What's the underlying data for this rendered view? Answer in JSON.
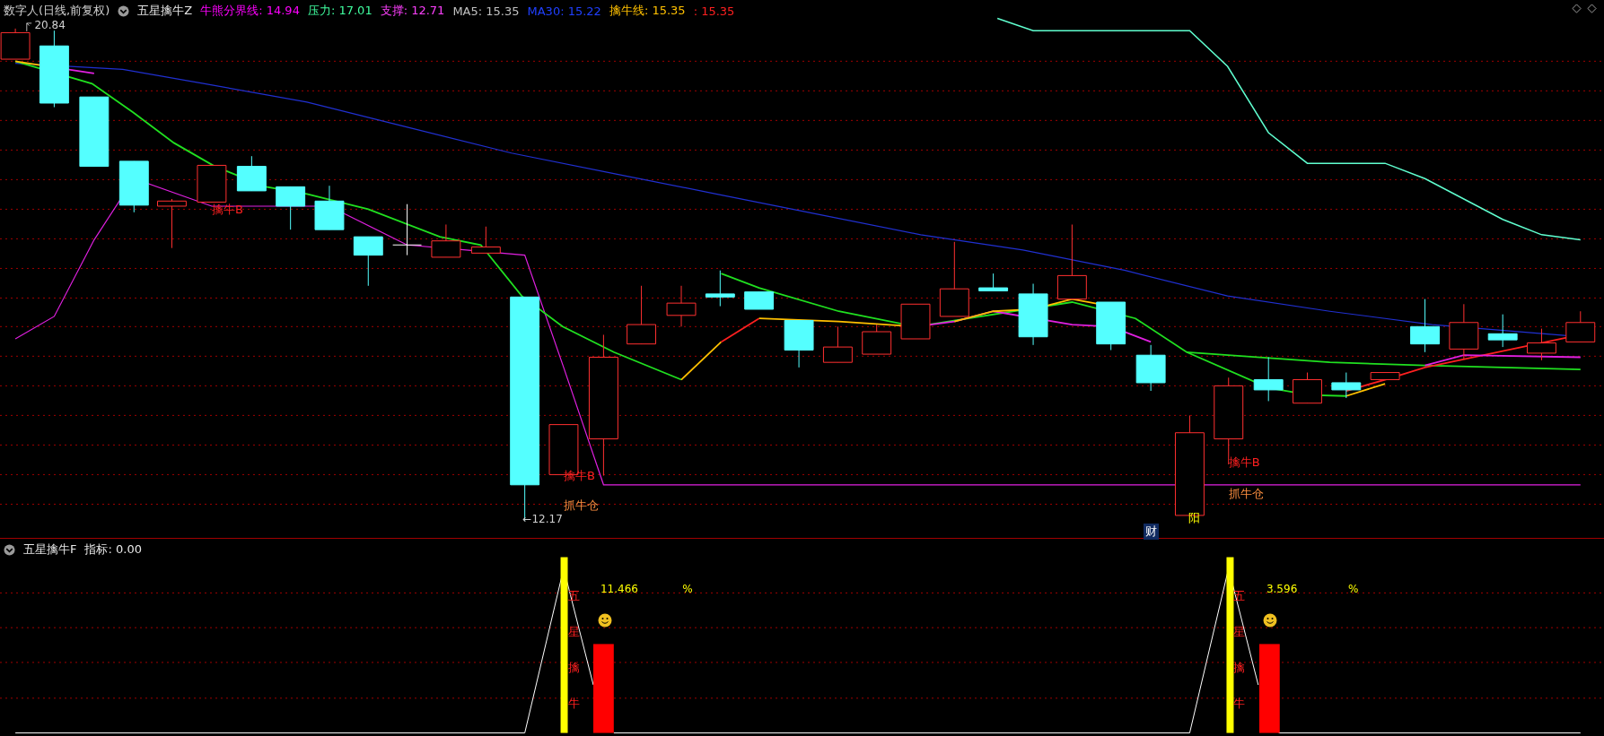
{
  "main_panel": {
    "stock": "数字人(日线,前复权)",
    "indicator": "五星擒牛Z",
    "legend": [
      {
        "text": "牛熊分界线: 14.94",
        "color": "#ff00ff"
      },
      {
        "text": "压力: 17.01",
        "color": "#40ffa0"
      },
      {
        "text": "支撑: 12.71",
        "color": "#ff40ff"
      },
      {
        "text": "MA5: 15.35",
        "color": "#c0c0c0"
      },
      {
        "text": "MA30: 15.22",
        "color": "#2040ff"
      },
      {
        "text": "擒牛线: 15.35",
        "color": "#ffc000"
      },
      {
        "text": ": 15.35",
        "color": "#ff2020"
      }
    ],
    "price_labels": [
      {
        "kind": "high",
        "text": "20.84"
      },
      {
        "kind": "low",
        "text": "←12.17"
      }
    ],
    "signals": [
      {
        "kind": "buy",
        "text": "擒牛B"
      },
      {
        "kind": "buy",
        "text": "擒牛B"
      },
      {
        "kind": "position",
        "text": "抓牛仓"
      },
      {
        "kind": "cai",
        "text": "财"
      },
      {
        "kind": "yang",
        "text": "阳"
      },
      {
        "kind": "buy",
        "text": "擒牛B"
      },
      {
        "kind": "position",
        "text": "抓牛仓"
      }
    ]
  },
  "sub_panel": {
    "indicator": "五星擒牛F",
    "reading": "指标: 0.00",
    "signals": [
      {
        "value": "11.466",
        "unit": "%",
        "vertical_text": "五星擒牛"
      },
      {
        "value": "3.596",
        "unit": "%",
        "vertical_text": "五星擒牛"
      }
    ]
  }
}
